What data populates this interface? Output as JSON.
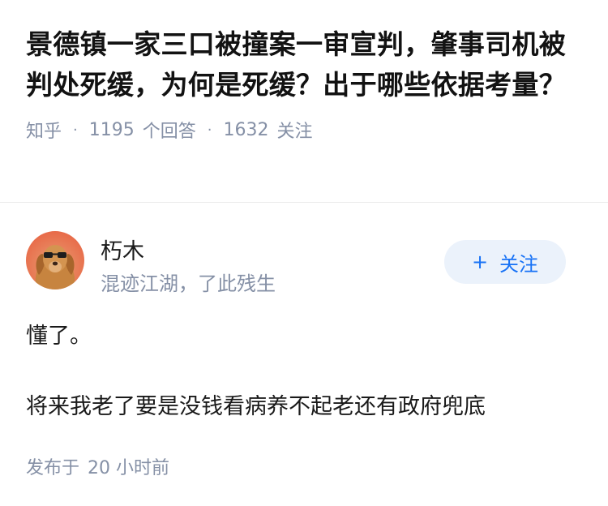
{
  "question": {
    "title": "景德镇一家三口被撞案一审宣判，肇事司机被判处死缓，为何是死缓？出于哪些依据考量？",
    "source": "知乎",
    "answer_count": "1195",
    "answer_label": "个回答",
    "follow_count": "1632",
    "follow_label": "关注"
  },
  "answer": {
    "author": {
      "name": "朽木",
      "bio": "混迹江湖，了此残生",
      "avatar_icon": "dog-with-sunglasses-avatar"
    },
    "follow_button": {
      "icon": "+",
      "label": "关注"
    },
    "paragraphs": [
      "懂了。",
      "将来我老了要是没钱看病养不起老还有政府兜底"
    ],
    "publish_label": "发布于",
    "publish_time": "20 小时前"
  },
  "colors": {
    "meta_gray": "#8590a6",
    "accent_blue": "#1772f6",
    "button_bg": "#ebf2fb"
  }
}
